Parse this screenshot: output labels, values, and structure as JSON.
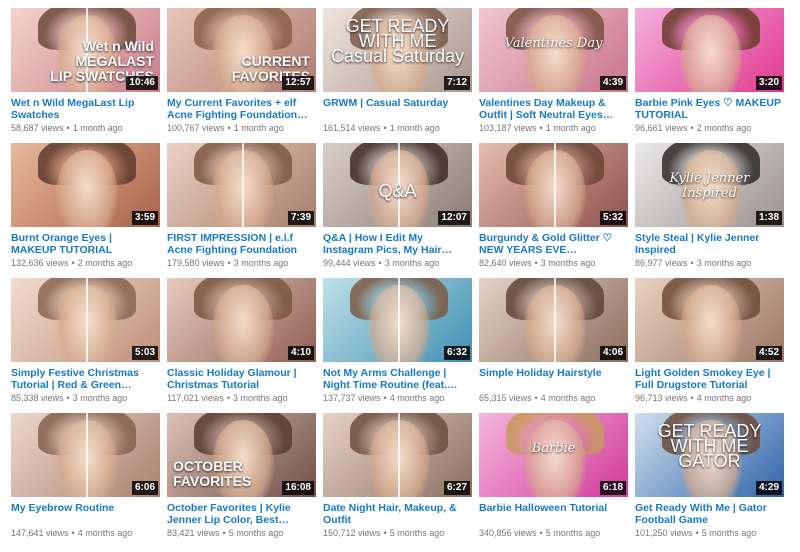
{
  "videos": [
    {
      "title": "Wet n Wild MegaLast Lip Swatches",
      "views": "58,687 views",
      "age": "1 month ago",
      "duration": "10:46",
      "overlay": "Wet n Wild\nMEGALAST\nLIP SWATCHES",
      "overlay_style": "right",
      "split": true,
      "colors": [
        "#f4d4c9",
        "#c97d8c"
      ],
      "hair": "#6b4a3a"
    },
    {
      "title": "My Current Favorites + elf Acne Fighting Foundation…",
      "views": "100,767 views",
      "age": "1 month ago",
      "duration": "12:57",
      "overlay": "CURRENT\nFAVORITES",
      "overlay_style": "right",
      "split": false,
      "colors": [
        "#e9c6b8",
        "#b07c72"
      ],
      "hair": "#8a5e48"
    },
    {
      "title": "GRWM | Casual Saturday",
      "views": "161,514 views",
      "age": "1 month ago",
      "duration": "7:12",
      "overlay": "GET READY WITH ME\nCasual Saturday",
      "overlay_style": "center",
      "split": false,
      "colors": [
        "#efe4dd",
        "#a9978f"
      ],
      "hair": "#7b5a48"
    },
    {
      "title": "Valentines Day Makeup & Outfit | Soft Neutral Eyes…",
      "views": "103,187 views",
      "age": "1 month ago",
      "duration": "4:39",
      "overlay": "Valentines Day",
      "overlay_style": "script",
      "split": false,
      "colors": [
        "#f1c6cf",
        "#c9748a"
      ],
      "hair": "#7a5040"
    },
    {
      "title": "Barbie Pink Eyes ♡ MAKEUP TUTORIAL",
      "views": "96,661 views",
      "age": "2 months ago",
      "duration": "3:20",
      "overlay": "",
      "overlay_style": "right",
      "split": false,
      "colors": [
        "#f3b0dd",
        "#e0388f"
      ],
      "hair": "#6a3a2a"
    },
    {
      "title": "Burnt Orange Eyes | MAKEUP TUTORIAL",
      "views": "132,636 views",
      "age": "2 months ago",
      "duration": "3:59",
      "overlay": "",
      "overlay_style": "right",
      "split": false,
      "colors": [
        "#e9b89c",
        "#a8634a"
      ],
      "hair": "#5f3b2c"
    },
    {
      "title": "FIRST IMPRESSION | e.l.f Acne Fighting Foundation",
      "views": "179,580 views",
      "age": "3 months ago",
      "duration": "7:39",
      "overlay": "",
      "overlay_style": "right",
      "split": true,
      "colors": [
        "#ecd2c4",
        "#a77c69"
      ],
      "hair": "#7d5843"
    },
    {
      "title": "Q&A | How I Edit My Instagram Pics, My Hair…",
      "views": "99,444 views",
      "age": "3 months ago",
      "duration": "12:07",
      "overlay": "Q&A",
      "overlay_style": "center",
      "split": true,
      "colors": [
        "#d8cfcb",
        "#8d7b75"
      ],
      "hair": "#3f2c24"
    },
    {
      "title": "Burgundy & Gold Glitter ♡ NEW YEARS EVE…",
      "views": "82,640 views",
      "age": "3 months ago",
      "duration": "5:32",
      "overlay": "",
      "overlay_style": "right",
      "split": true,
      "colors": [
        "#e6bdb0",
        "#8e4f4a"
      ],
      "hair": "#6a4333"
    },
    {
      "title": "Style Steal | Kylie Jenner Inspired",
      "views": "86,977 views",
      "age": "3 months ago",
      "duration": "1:38",
      "overlay": "Kylie Jenner\nInspired",
      "overlay_style": "script",
      "split": false,
      "colors": [
        "#eaeaea",
        "#9a8f8c"
      ],
      "hair": "#2e2a2a"
    },
    {
      "title": "Simply Festive Christmas Tutorial | Red & Green…",
      "views": "85,338 views",
      "age": "3 months ago",
      "duration": "5:03",
      "overlay": "",
      "overlay_style": "right",
      "split": true,
      "colors": [
        "#f1dccf",
        "#bf8f7a"
      ],
      "hair": "#8b6450"
    },
    {
      "title": "Classic Holiday Glamour | Christmas Tutorial",
      "views": "117,021 views",
      "age": "3 months ago",
      "duration": "4:10",
      "overlay": "",
      "overlay_style": "right",
      "split": false,
      "colors": [
        "#e8cbbd",
        "#8f5e55"
      ],
      "hair": "#7a553f"
    },
    {
      "title": "Not My Arms Challenge | Night Time Routine (feat.…",
      "views": "137,737 views",
      "age": "4 months ago",
      "duration": "6:32",
      "overlay": "",
      "overlay_style": "right",
      "split": true,
      "colors": [
        "#bfe0ea",
        "#3f8fb2"
      ],
      "hair": "#7b5a44"
    },
    {
      "title": "Simple Holiday Hairstyle",
      "views": "65,315 views",
      "age": "4 months ago",
      "duration": "4:06",
      "overlay": "",
      "overlay_style": "right",
      "split": true,
      "colors": [
        "#e3d3c8",
        "#8d6c5c"
      ],
      "hair": "#5f4536"
    },
    {
      "title": "Light Golden Smokey Eye | Full Drugstore Tutorial",
      "views": "96,713 views",
      "age": "4 months ago",
      "duration": "4:52",
      "overlay": "",
      "overlay_style": "right",
      "split": false,
      "colors": [
        "#ead2c2",
        "#9c7564"
      ],
      "hair": "#6e4b39"
    },
    {
      "title": "My Eyebrow Routine",
      "views": "147,641 views",
      "age": "4 months ago",
      "duration": "6:06",
      "overlay": "",
      "overlay_style": "right",
      "split": true,
      "colors": [
        "#eed8cc",
        "#a88070"
      ],
      "hair": "#86614c"
    },
    {
      "title": "October Favorites | Kylie Jenner Lip Color, Best…",
      "views": "83,421 views",
      "age": "5 months ago",
      "duration": "16:08",
      "overlay": "OCTOBER\nFAVORITES",
      "overlay_style": "left",
      "split": false,
      "colors": [
        "#dcc1b6",
        "#6f4e47"
      ],
      "hair": "#5a3c2f"
    },
    {
      "title": "Date Night Hair, Makeup, & Outfit",
      "views": "150,712 views",
      "age": "5 months ago",
      "duration": "6:27",
      "overlay": "",
      "overlay_style": "right",
      "split": true,
      "colors": [
        "#e7d3c6",
        "#8a6e61"
      ],
      "hair": "#6d4e3c"
    },
    {
      "title": "Barbie Halloween Tutorial",
      "views": "340,856 views",
      "age": "5 months ago",
      "duration": "6:18",
      "overlay": "Barbie",
      "overlay_style": "script",
      "split": false,
      "colors": [
        "#f5b6de",
        "#d13a9a"
      ],
      "hair": "#c79a5c"
    },
    {
      "title": "Get Ready With Me | Gator Football Game",
      "views": "101,250 views",
      "age": "5 months ago",
      "duration": "4:29",
      "overlay": "GET READY WITH ME\nGATOR",
      "overlay_style": "center",
      "split": false,
      "colors": [
        "#cfe0ef",
        "#2f63a8"
      ],
      "hair": "#6d4b38"
    }
  ],
  "meta_separator": "•"
}
